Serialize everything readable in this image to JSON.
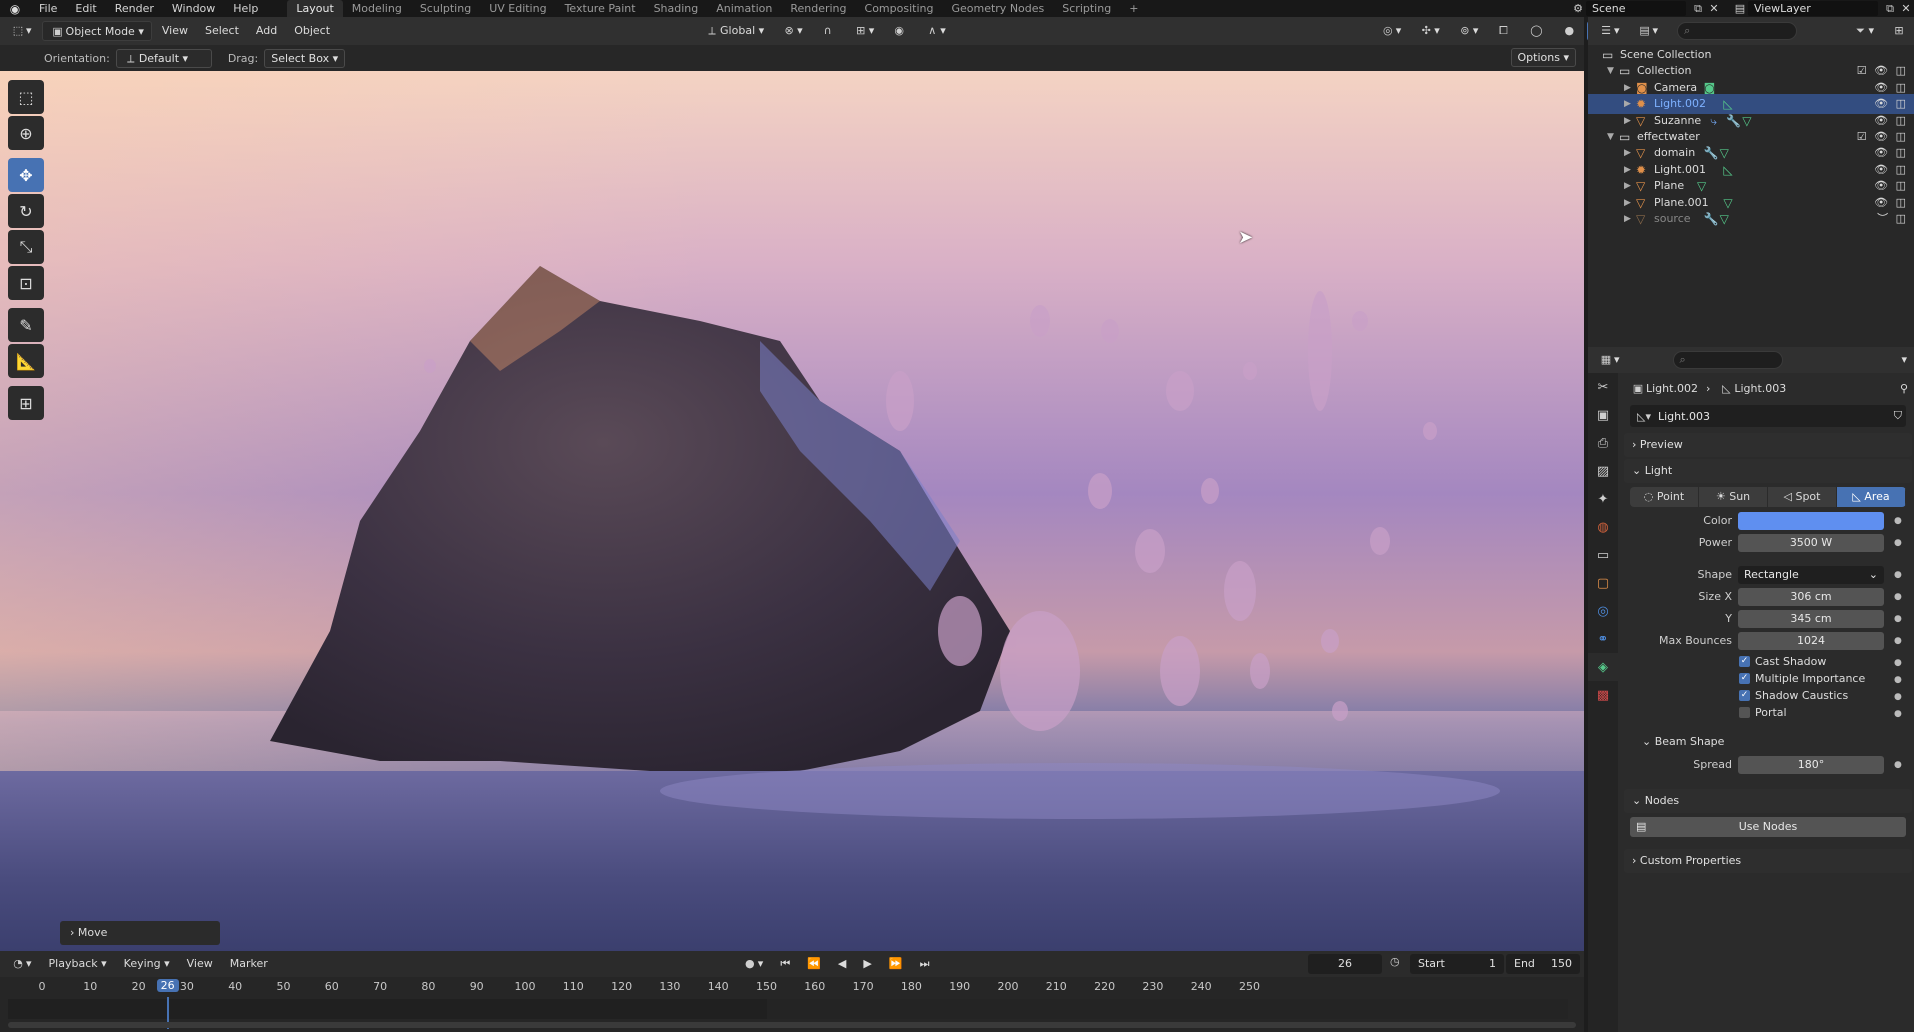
{
  "menu": [
    "File",
    "Edit",
    "Render",
    "Window",
    "Help"
  ],
  "workspaces": [
    "Layout",
    "Modeling",
    "Sculpting",
    "UV Editing",
    "Texture Paint",
    "Shading",
    "Animation",
    "Rendering",
    "Compositing",
    "Geometry Nodes",
    "Scripting"
  ],
  "active_workspace": "Layout",
  "top_right": {
    "scene": "Scene",
    "view_layer": "ViewLayer"
  },
  "viewport_header": {
    "mode": "Object Mode",
    "menus": [
      "View",
      "Select",
      "Add",
      "Object"
    ],
    "transform_orientation": "Global"
  },
  "tool_settings": {
    "orientation_label": "Orientation:",
    "orientation_value": "Default",
    "drag_label": "Drag:",
    "drag_value": "Select Box",
    "options_label": "Options"
  },
  "toolbar": [
    "select-box",
    "cursor",
    "move",
    "rotate",
    "scale",
    "transform",
    "annotate",
    "measure",
    "add-cube"
  ],
  "active_tool": "move",
  "last_operator": "Move",
  "timeline": {
    "menus": [
      "Playback",
      "Keying",
      "View",
      "Marker"
    ],
    "current_frame": "26",
    "start_label": "Start",
    "start": "1",
    "end_label": "End",
    "end": "150",
    "ticks": [
      "0",
      "10",
      "20",
      "30",
      "40",
      "50",
      "60",
      "70",
      "80",
      "90",
      "100",
      "110",
      "120",
      "130",
      "140",
      "150",
      "160",
      "170",
      "180",
      "190",
      "200",
      "210",
      "220",
      "230",
      "240",
      "250"
    ],
    "playhead_label": "26"
  },
  "outliner": {
    "rows": [
      {
        "name": "Scene Collection",
        "kind": "scene-collection",
        "depth": 0,
        "expanded": true
      },
      {
        "name": "Collection",
        "kind": "collection",
        "depth": 1,
        "expanded": true
      },
      {
        "name": "Camera",
        "kind": "camera",
        "depth": 2,
        "extras": [
          "camera-data-icon"
        ]
      },
      {
        "name": "Light.002",
        "kind": "light",
        "depth": 2,
        "selected": true,
        "extras": [
          "light-data-icon"
        ]
      },
      {
        "name": "Suzanne",
        "kind": "mesh",
        "depth": 2,
        "extras": [
          "modifier-icon",
          "wrench-icon",
          "mesh-data-icon"
        ]
      },
      {
        "name": "effectwater",
        "kind": "collection",
        "depth": 1,
        "expanded": true
      },
      {
        "name": "domain",
        "kind": "mesh",
        "depth": 2,
        "extras": [
          "wrench-icon",
          "mesh-data-icon"
        ]
      },
      {
        "name": "Light.001",
        "kind": "light",
        "depth": 2,
        "extras": [
          "light-data-icon"
        ]
      },
      {
        "name": "Plane",
        "kind": "mesh",
        "depth": 2,
        "extras": [
          "mesh-data-icon"
        ]
      },
      {
        "name": "Plane.001",
        "kind": "mesh",
        "depth": 2,
        "extras": [
          "mesh-data-icon"
        ]
      },
      {
        "name": "source",
        "kind": "mesh",
        "depth": 2,
        "dim": true,
        "extras": [
          "wrench-icon",
          "mesh-data-icon"
        ]
      }
    ]
  },
  "properties": {
    "breadcrumb_object": "Light.002",
    "breadcrumb_data": "Light.003",
    "datablock_name": "Light.003",
    "panels": {
      "preview": "Preview",
      "light": "Light",
      "beam_shape": "Beam Shape",
      "nodes": "Nodes",
      "custom_properties": "Custom Properties"
    },
    "light_types": [
      "Point",
      "Sun",
      "Spot",
      "Area"
    ],
    "active_light_type": "Area",
    "color_label": "Color",
    "color_value": "#5f8ff0",
    "power_label": "Power",
    "power": "3500 W",
    "shape_label": "Shape",
    "shape": "Rectangle",
    "size_x_label": "Size X",
    "size_x": "306 cm",
    "size_y_label": "Y",
    "size_y": "345 cm",
    "max_bounces_label": "Max Bounces",
    "max_bounces": "1024",
    "checkboxes": [
      {
        "label": "Cast Shadow",
        "checked": true
      },
      {
        "label": "Multiple Importance",
        "checked": true
      },
      {
        "label": "Shadow Caustics",
        "checked": true
      },
      {
        "label": "Portal",
        "checked": false
      }
    ],
    "spread_label": "Spread",
    "spread": "180°",
    "use_nodes_label": "Use Nodes"
  },
  "colors": {
    "accent": "#4772b3",
    "selected_row": "#334d80",
    "data_green": "#55c88a",
    "object_orange": "#e0904a"
  }
}
